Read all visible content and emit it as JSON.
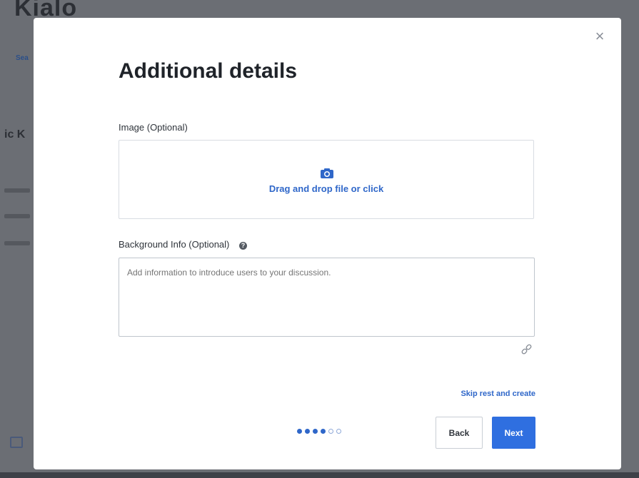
{
  "background": {
    "app_title": "Kialo",
    "link_text": "Sea",
    "heading": "ic K"
  },
  "modal": {
    "close_label": "×",
    "title": "Additional details",
    "image_field": {
      "label": "Image (Optional)",
      "dropzone_text": "Drag and drop file or click",
      "icon": "camera-icon"
    },
    "background_field": {
      "label": "Background Info (Optional)",
      "help_icon_glyph": "?",
      "placeholder": "Add information to introduce users to your discussion."
    },
    "skip_link": "Skip rest and create",
    "progress": {
      "total_steps": 6,
      "completed_steps": 4
    },
    "buttons": {
      "back": "Back",
      "next": "Next"
    }
  },
  "colors": {
    "accent": "#2f6fe0",
    "link": "#2f67c9",
    "overlay": "#6b6e74"
  }
}
